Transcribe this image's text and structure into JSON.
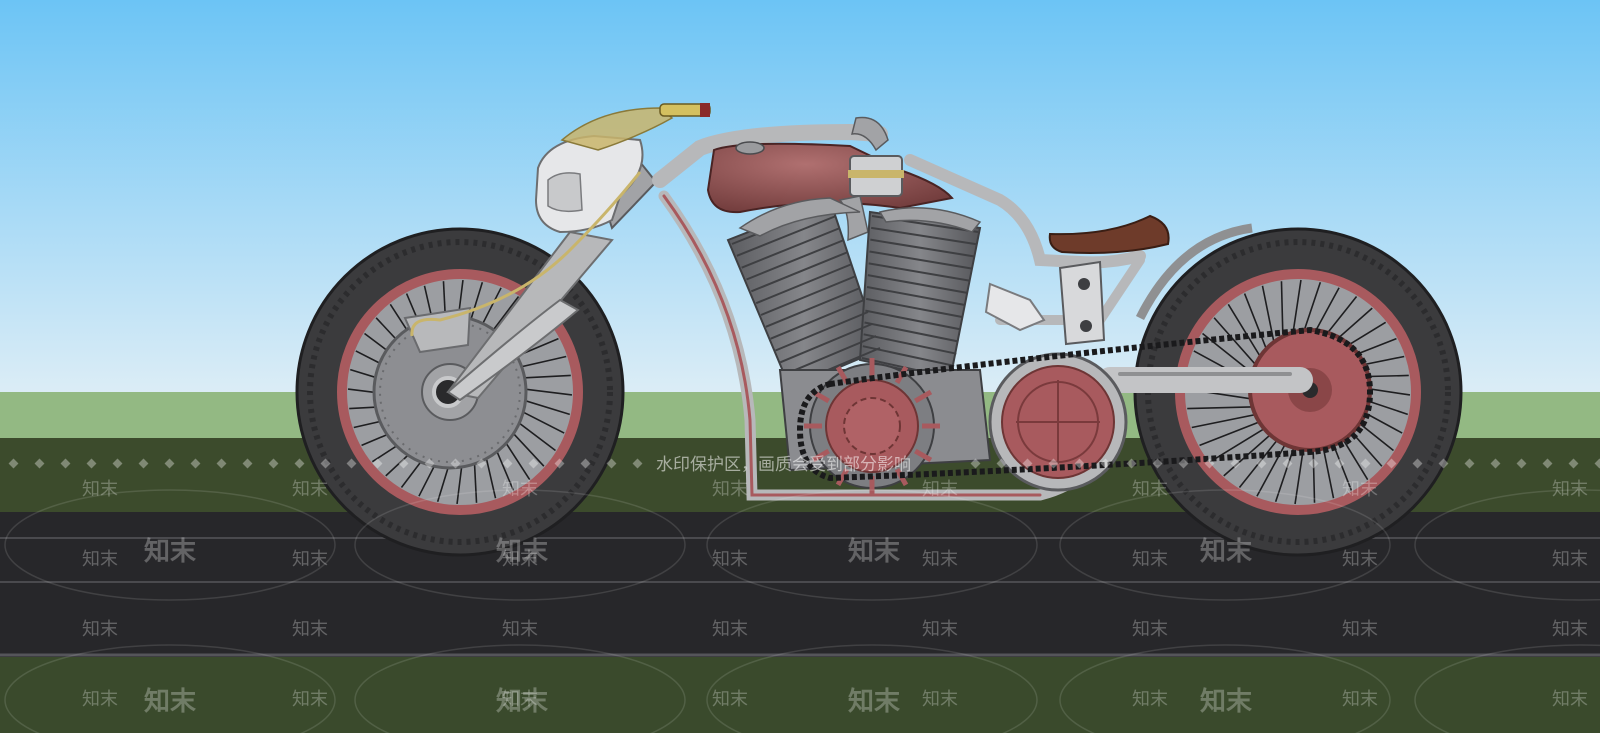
{
  "watermark": {
    "banner_text": "水印保护区，画质会受到部分影响",
    "brand_small": "知末",
    "brand_large": "知末"
  },
  "colors": {
    "sky_top": "#6cc4f5",
    "sky_bottom": "#d8ecf6",
    "grass_far": "#93b983",
    "grass_near": "#3c4b2c",
    "road": "#27272a",
    "tank": "#8a4a4a",
    "rim": "#a85a5e",
    "tire": "#3b3b3d",
    "frame": "#b7b8ba",
    "engine": "#6d6e72",
    "seat": "#6e3b2a",
    "brass": "#c9b56b"
  }
}
